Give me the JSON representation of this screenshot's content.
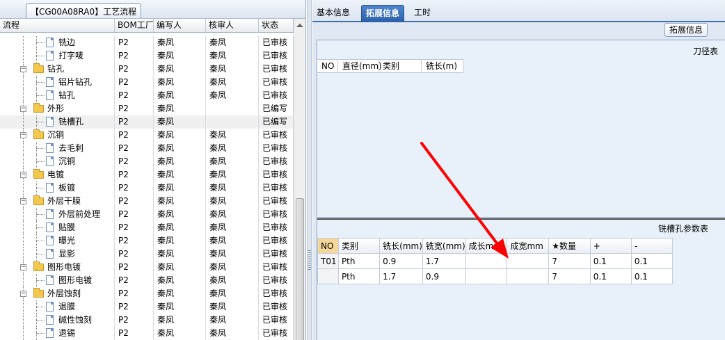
{
  "left_panel": {
    "tab_label": "【CG00A08RA0】工艺流程",
    "columns": [
      "流程",
      "BOM工厂",
      "编写人",
      "核审人",
      "状态"
    ],
    "rows": [
      {
        "label": "铣边",
        "type": "file",
        "bom": "P2",
        "writer": "秦凤",
        "reviewer": "秦凤",
        "status": "已审核"
      },
      {
        "label": "打字唛",
        "type": "file",
        "bom": "P2",
        "writer": "秦凤",
        "reviewer": "秦凤",
        "status": "已审核"
      },
      {
        "label": "钻孔",
        "type": "folder",
        "bom": "P2",
        "writer": "秦凤",
        "reviewer": "秦凤",
        "status": "已审核"
      },
      {
        "label": "铝片钻孔",
        "type": "file",
        "bom": "P2",
        "writer": "秦凤",
        "reviewer": "秦凤",
        "status": "已审核"
      },
      {
        "label": "钻孔",
        "type": "file",
        "bom": "P2",
        "writer": "秦凤",
        "reviewer": "秦凤",
        "status": "已审核"
      },
      {
        "label": "外形",
        "type": "folder",
        "bom": "P2",
        "writer": "秦凤",
        "reviewer": "",
        "status": "已编写"
      },
      {
        "label": "铣槽孔",
        "type": "file",
        "bom": "P2",
        "writer": "秦凤",
        "reviewer": "",
        "status": "已编写",
        "selected": true
      },
      {
        "label": "沉铜",
        "type": "folder",
        "bom": "P2",
        "writer": "秦凤",
        "reviewer": "秦凤",
        "status": "已审核"
      },
      {
        "label": "去毛刺",
        "type": "file",
        "bom": "P2",
        "writer": "秦凤",
        "reviewer": "秦凤",
        "status": "已审核"
      },
      {
        "label": "沉铜",
        "type": "file",
        "bom": "P2",
        "writer": "秦凤",
        "reviewer": "秦凤",
        "status": "已审核"
      },
      {
        "label": "电镀",
        "type": "folder",
        "bom": "P2",
        "writer": "秦凤",
        "reviewer": "秦凤",
        "status": "已审核"
      },
      {
        "label": "板镀",
        "type": "file",
        "bom": "P2",
        "writer": "秦凤",
        "reviewer": "秦凤",
        "status": "已审核"
      },
      {
        "label": "外层干膜",
        "type": "folder",
        "bom": "P2",
        "writer": "秦凤",
        "reviewer": "秦凤",
        "status": "已审核"
      },
      {
        "label": "外层前处理",
        "type": "file",
        "bom": "P2",
        "writer": "秦凤",
        "reviewer": "秦凤",
        "status": "已审核"
      },
      {
        "label": "贴膜",
        "type": "file",
        "bom": "P2",
        "writer": "秦凤",
        "reviewer": "秦凤",
        "status": "已审核"
      },
      {
        "label": "曝光",
        "type": "file",
        "bom": "P2",
        "writer": "秦凤",
        "reviewer": "秦凤",
        "status": "已审核"
      },
      {
        "label": "显影",
        "type": "file",
        "bom": "P2",
        "writer": "秦凤",
        "reviewer": "秦凤",
        "status": "已审核"
      },
      {
        "label": "图形电镀",
        "type": "folder",
        "bom": "P2",
        "writer": "秦凤",
        "reviewer": "秦凤",
        "status": "已审核"
      },
      {
        "label": "图形电镀",
        "type": "file",
        "bom": "P2",
        "writer": "秦凤",
        "reviewer": "秦凤",
        "status": "已审核"
      },
      {
        "label": "外层蚀刻",
        "type": "folder",
        "bom": "P2",
        "writer": "秦凤",
        "reviewer": "秦凤",
        "status": "已审核"
      },
      {
        "label": "退膜",
        "type": "file",
        "bom": "P2",
        "writer": "秦凤",
        "reviewer": "秦凤",
        "status": "已审核"
      },
      {
        "label": "碱性蚀刻",
        "type": "file",
        "bom": "P2",
        "writer": "秦凤",
        "reviewer": "秦凤",
        "status": "已审核"
      },
      {
        "label": "退锡",
        "type": "file",
        "bom": "P2",
        "writer": "秦凤",
        "reviewer": "秦凤",
        "status": "已审核"
      }
    ]
  },
  "right_panel": {
    "tabs": [
      "基本信息",
      "拓展信息",
      "工时"
    ],
    "active_tab": "拓展信息",
    "ext_badge": "拓展信息",
    "knife_table": {
      "title": "刀径表",
      "columns": [
        "NO",
        "直径(mm)",
        "类别",
        "铣长(m)"
      ]
    },
    "slot_table": {
      "title": "铣槽孔参数表",
      "columns": [
        "NO",
        "类别",
        "铣长(mm)",
        "铣宽(mm)",
        "成长mm",
        "成宽mm",
        "★数量",
        "+",
        "-"
      ],
      "rows": [
        [
          "T01",
          "Pth",
          "0.9",
          "1.7",
          "",
          "",
          "7",
          "0.1",
          "0.1"
        ],
        [
          "",
          "Pth",
          "1.7",
          "0.9",
          "",
          "",
          "7",
          "0.1",
          "0.1"
        ]
      ]
    }
  },
  "colors": {
    "active_tab": "#2a5fa8",
    "no_header": "#f7d69a",
    "annotation_arrow": "#ff0000"
  }
}
